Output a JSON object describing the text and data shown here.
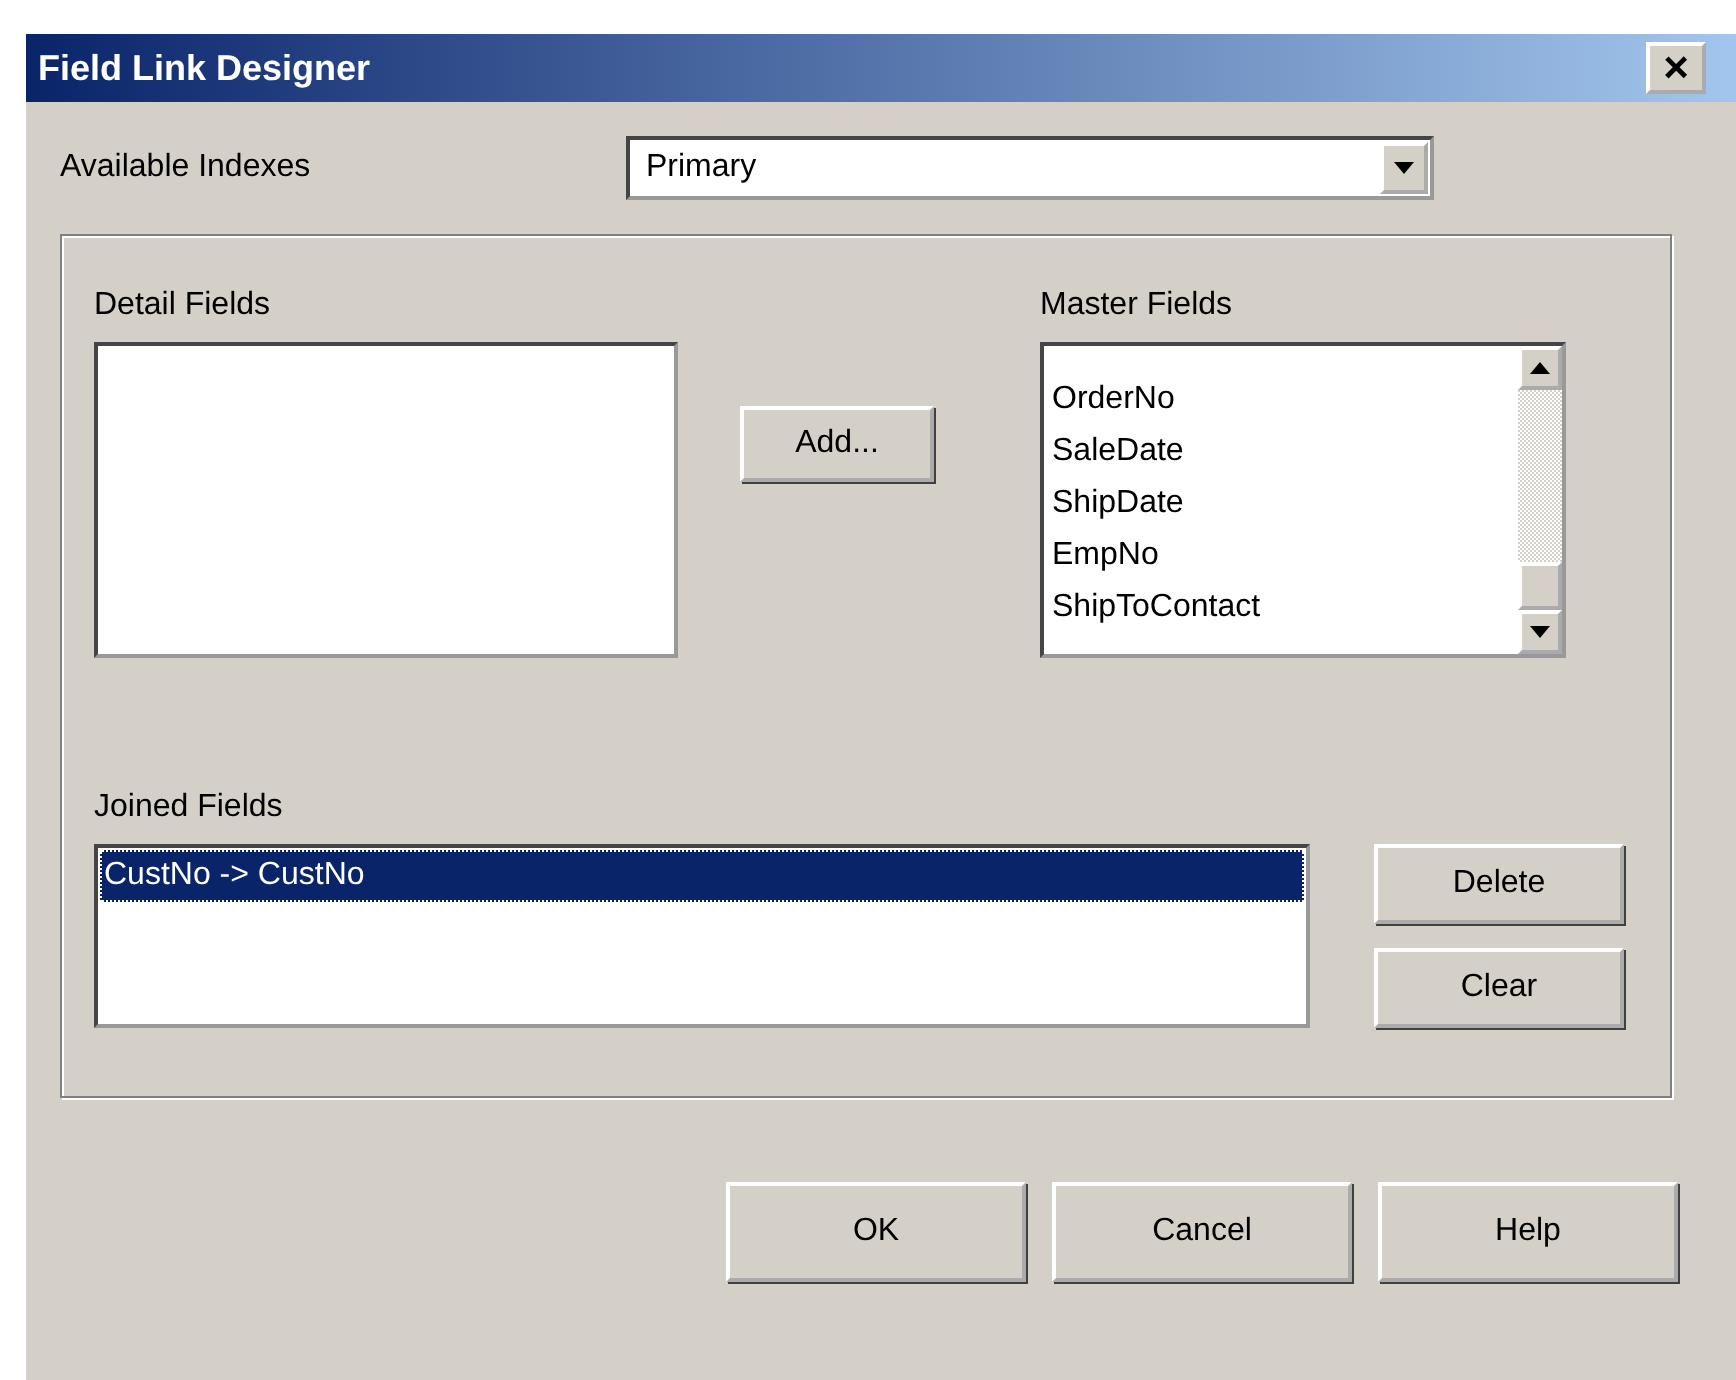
{
  "window": {
    "title": "Field Link Designer",
    "close": "×"
  },
  "indexes": {
    "label": "Available Indexes",
    "value": "Primary"
  },
  "detail_fields": {
    "label": "Detail Fields"
  },
  "add_button": "Add...",
  "master_fields": {
    "label": "Master Fields",
    "items": [
      {
        "text": "OrderNo",
        "selected": false
      },
      {
        "text": "SaleDate",
        "selected": false
      },
      {
        "text": "ShipDate",
        "selected": false
      },
      {
        "text": "EmpNo",
        "selected": false
      },
      {
        "text": "ShipToContact",
        "selected": false
      }
    ]
  },
  "joined_fields": {
    "label": "Joined Fields",
    "items": [
      {
        "text": "CustNo -> CustNo",
        "selected": true
      }
    ]
  },
  "side_buttons": [
    "Delete",
    "Clear"
  ],
  "buttons": [
    "OK",
    "Cancel",
    "Help"
  ]
}
